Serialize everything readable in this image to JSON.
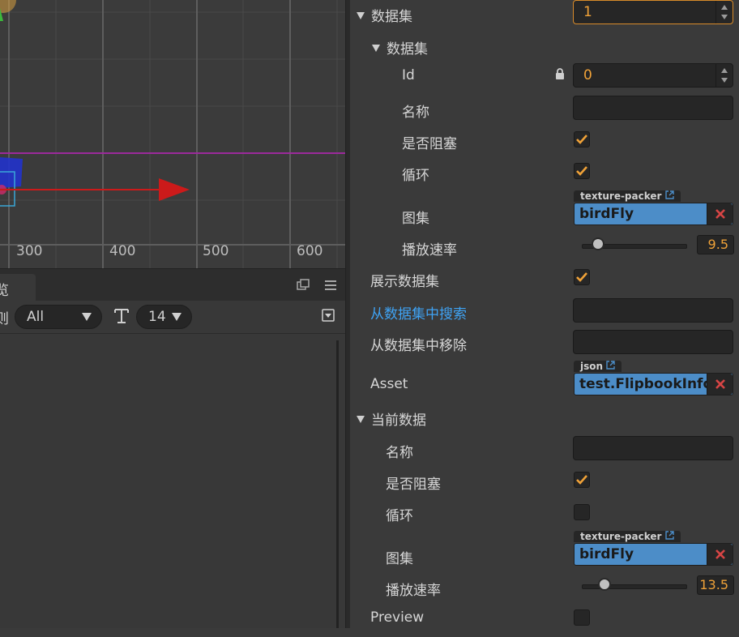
{
  "scene": {
    "x_ticks": [
      "300",
      "400",
      "500",
      "600"
    ],
    "colors": {
      "background": "#3b3b3b",
      "grid": "#4a4a4a",
      "x_axis_arrow": "#cc1a1a",
      "guide_line": "#9b2a9b"
    }
  },
  "console": {
    "tab_label": "览",
    "toolbar_left_label": "则",
    "level_select": "All",
    "font_size_select": "14"
  },
  "inspector": {
    "dataset_count_label": "数据集",
    "dataset_count_value": "1",
    "dataset_group_label": "数据集",
    "id_label": "Id",
    "id_value": "0",
    "name_label": "名称",
    "name_value": "",
    "blocking_label": "是否阻塞",
    "blocking_checked": true,
    "loop_label": "循环",
    "loop_checked": true,
    "atlas_tag": "texture-packer",
    "atlas_label": "图集",
    "atlas_value": "birdFly",
    "speed_label": "播放速率",
    "speed_value": "9.5",
    "show_dataset_label": "展示数据集",
    "show_dataset_checked": true,
    "search_label": "从数据集中搜索",
    "remove_label": "从数据集中移除",
    "asset_tag": "json",
    "asset_label": "Asset",
    "asset_value": "test.FlipbookInfo",
    "current_label": "当前数据",
    "cur_name_label": "名称",
    "cur_blocking_label": "是否阻塞",
    "cur_blocking_checked": true,
    "cur_loop_label": "循环",
    "cur_loop_checked": false,
    "cur_atlas_tag": "texture-packer",
    "cur_atlas_label": "图集",
    "cur_atlas_value": "birdFly",
    "cur_speed_label": "播放速率",
    "cur_speed_value": "13.5",
    "preview_label": "Preview",
    "preview_checked": false,
    "colors": {
      "accent": "#f0a238",
      "asset": "#4c8dc8",
      "link": "#3fa3f4",
      "remove_x": "#d64545"
    }
  }
}
